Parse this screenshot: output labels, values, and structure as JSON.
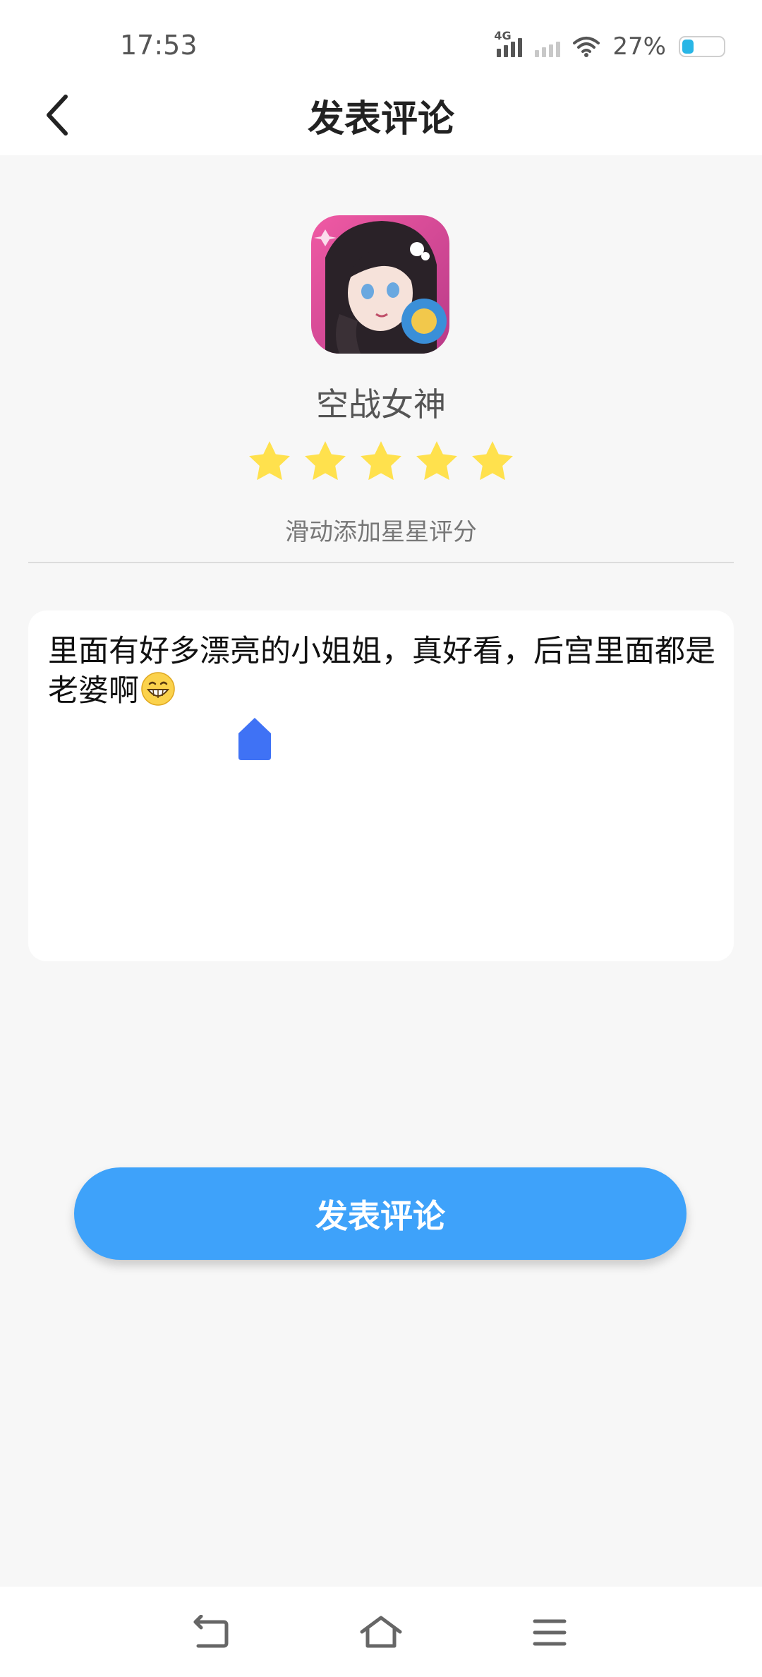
{
  "status_bar": {
    "time": "17:53",
    "network_tag": "4G",
    "battery_percent": "27%",
    "battery_level": 0.27,
    "icons": [
      "signal-4g-icon",
      "signal-sim2-icon",
      "wifi-icon",
      "battery-icon"
    ]
  },
  "header": {
    "title": "发表评论",
    "back_icon": "chevron-left-icon"
  },
  "app": {
    "name": "空战女神",
    "icon": "game-app-icon"
  },
  "rating": {
    "stars_filled": 5,
    "stars_total": 5,
    "star_color": "#FFE14D",
    "hint": "滑动添加星星评分"
  },
  "comment": {
    "text": "里面有好多漂亮的小姐姐，真好看，后宫里面都是老婆啊",
    "emoji": "grinning-face-emoji",
    "cursor_color": "#3F72F5"
  },
  "submit_button": {
    "label": "发表评论",
    "color": "#3EA2FA"
  },
  "nav_bar": {
    "icons": [
      "back-nav-icon",
      "home-nav-icon",
      "menu-nav-icon"
    ]
  }
}
